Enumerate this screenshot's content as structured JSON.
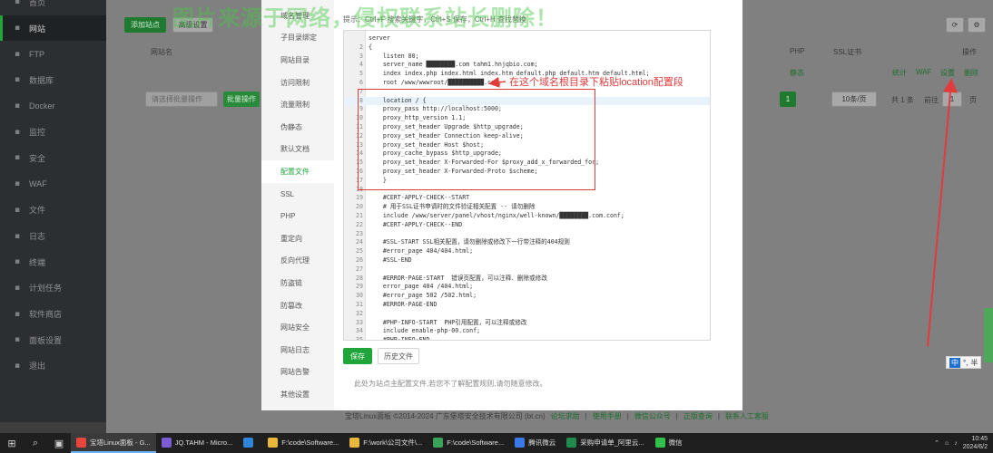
{
  "sidebar": {
    "items": [
      {
        "label": "首页",
        "icon": "home-icon"
      },
      {
        "label": "网站",
        "icon": "globe-icon"
      },
      {
        "label": "FTP",
        "icon": "ftp-icon"
      },
      {
        "label": "数据库",
        "icon": "database-icon"
      },
      {
        "label": "Docker",
        "icon": "docker-icon"
      },
      {
        "label": "监控",
        "icon": "monitor-icon"
      },
      {
        "label": "安全",
        "icon": "shield-icon"
      },
      {
        "label": "WAF",
        "icon": "firewall-icon"
      },
      {
        "label": "文件",
        "icon": "folder-icon"
      },
      {
        "label": "日志",
        "icon": "log-icon"
      },
      {
        "label": "终端",
        "icon": "terminal-icon"
      },
      {
        "label": "计划任务",
        "icon": "clock-icon"
      },
      {
        "label": "软件商店",
        "icon": "store-icon"
      },
      {
        "label": "面板设置",
        "icon": "gear-icon"
      },
      {
        "label": "退出",
        "icon": "logout-icon"
      }
    ],
    "active_index": 1
  },
  "background": {
    "add_site": "添加站点",
    "advanced": "高级设置",
    "col_site": "网站名",
    "col_php": "PHP",
    "col_ssl": "SSL证书",
    "col_action": "操作",
    "row_php": "静态",
    "row_actions": [
      "统计",
      "WAF",
      "设置",
      "删除"
    ],
    "batch_placeholder": "请选择批量操作",
    "batch_btn": "批量操作",
    "page_current": "1",
    "page_size": "10条/页",
    "total": "共 1 条",
    "goto": "前往",
    "goto_value": "1",
    "page_unit": "页"
  },
  "footer": {
    "copyright": "宝塔Linux面板 ©2014-2024 广东堡塔安全技术有限公司 (bt.cn)",
    "links": [
      "论坛求助",
      "使用手册",
      "微信公众号",
      "正版查询",
      "联系人工客服"
    ]
  },
  "watermark": "图片来源于网络，侵权联系站长删除！",
  "modal": {
    "nav": [
      "域名管理",
      "子目录绑定",
      "网站目录",
      "访问限制",
      "流量限制",
      "伪静态",
      "默认文档",
      "配置文件",
      "SSL",
      "PHP",
      "重定向",
      "反向代理",
      "防盗链",
      "防篡改",
      "网站安全",
      "网站日志",
      "网站告警",
      "其他设置"
    ],
    "active_nav": 7,
    "hint": "提示：Ctrl+F 搜索关键字，Ctrl+S 保存，Ctrl+H 查找替换",
    "save": "保存",
    "history": "历史文件",
    "note": "此处为站点主配置文件,若您不了解配置规则,请勿随意修改。",
    "annotation": "在这个域名根目录下粘贴location配置段"
  },
  "code": [
    {
      "n": "",
      "t": "server",
      "c": "c-blue"
    },
    {
      "n": "2",
      "t": "{",
      "c": "c-dark"
    },
    {
      "n": "3",
      "t": "    listen 80;",
      "c": "c-dark"
    },
    {
      "n": "4",
      "t": "    server_name ████████.com tahm1.hnjqbio.com;",
      "c": "c-dark"
    },
    {
      "n": "5",
      "t": "    index index.php index.html index.htm default.php default.htm default.html;",
      "c": "c-dark"
    },
    {
      "n": "6",
      "t": "    root /www/wwwroot/██████████.com;",
      "c": "c-dark"
    },
    {
      "n": "7",
      "t": "",
      "c": "c-dark"
    },
    {
      "n": "8",
      "t": "    location / {",
      "c": "c-dark"
    },
    {
      "n": "9",
      "t": "    proxy_pass http://localhost:5000;",
      "c": "c-dark"
    },
    {
      "n": "10",
      "t": "    proxy_http_version 1.1;",
      "c": "c-dark"
    },
    {
      "n": "11",
      "t": "    proxy_set_header Upgrade $http_upgrade;",
      "c": "c-dark"
    },
    {
      "n": "12",
      "t": "    proxy_set_header Connection keep-alive;",
      "c": "c-dark"
    },
    {
      "n": "13",
      "t": "    proxy_set_header Host $host;",
      "c": "c-dark"
    },
    {
      "n": "14",
      "t": "    proxy_cache_bypass $http_upgrade;",
      "c": "c-dark"
    },
    {
      "n": "15",
      "t": "    proxy_set_header X-Forwarded-For $proxy_add_x_forwarded_for;",
      "c": "c-dark"
    },
    {
      "n": "16",
      "t": "    proxy_set_header X-Forwarded-Proto $scheme;",
      "c": "c-dark"
    },
    {
      "n": "17",
      "t": "    }",
      "c": "c-dark"
    },
    {
      "n": "18",
      "t": "",
      "c": "c-dark"
    },
    {
      "n": "19",
      "t": "    #CERT-APPLY-CHECK--START",
      "c": "c-green"
    },
    {
      "n": "20",
      "t": "    # 用于SSL证书申请时的文件验证相关配置 -- 请勿删除",
      "c": "c-green"
    },
    {
      "n": "21",
      "t": "    include /www/server/panel/vhost/nginx/well-known/████████.com.conf;",
      "c": "c-dark"
    },
    {
      "n": "22",
      "t": "    #CERT-APPLY-CHECK--END",
      "c": "c-green"
    },
    {
      "n": "23",
      "t": "",
      "c": "c-dark"
    },
    {
      "n": "24",
      "t": "    #SSL-START SSL相关配置，请勿删除或修改下一行带注释的404规则",
      "c": "c-green"
    },
    {
      "n": "25",
      "t": "    #error_page 404/404.html;",
      "c": "c-green"
    },
    {
      "n": "26",
      "t": "    #SSL-END",
      "c": "c-green"
    },
    {
      "n": "27",
      "t": "",
      "c": "c-dark"
    },
    {
      "n": "28",
      "t": "    #ERROR-PAGE-START  错误页配置，可以注释、删除或修改",
      "c": "c-green"
    },
    {
      "n": "29",
      "t": "    error_page 404 /404.html;",
      "c": "c-dark"
    },
    {
      "n": "30",
      "t": "    #error_page 502 /502.html;",
      "c": "c-green"
    },
    {
      "n": "31",
      "t": "    #ERROR-PAGE-END",
      "c": "c-green"
    },
    {
      "n": "32",
      "t": "",
      "c": "c-dark"
    },
    {
      "n": "33",
      "t": "    #PHP-INFO-START  PHP引用配置，可以注释或修改",
      "c": "c-green"
    },
    {
      "n": "34",
      "t": "    include enable-php-00.conf;",
      "c": "c-dark"
    },
    {
      "n": "35",
      "t": "    #PHP-INFO-END",
      "c": "c-green"
    }
  ],
  "taskbar": {
    "tasks": [
      {
        "label": "宝塔Linux面板 - G...",
        "color": "#e8453c",
        "active": true
      },
      {
        "label": "JQ.TAHM - Micro...",
        "color": "#7b5cd6",
        "active": false
      },
      {
        "label": "",
        "color": "#2f86d8",
        "active": false
      },
      {
        "label": "F:\\code\\Software...",
        "color": "#e8b83c",
        "active": false
      },
      {
        "label": "F:\\work\\公司文件\\...",
        "color": "#e8b83c",
        "active": false
      },
      {
        "label": "F:\\code\\Software...",
        "color": "#3aa35a",
        "active": false
      },
      {
        "label": "腾讯微云",
        "color": "#3a7ae8",
        "active": false
      },
      {
        "label": "采购申请单_阿里云...",
        "color": "#1f8a4a",
        "active": false
      },
      {
        "label": "微信",
        "color": "#2ec24a",
        "active": false
      }
    ],
    "time": "10:45",
    "date": "2024/6/2"
  },
  "ime": {
    "lang": "中",
    "mode": "°,",
    "half": "半"
  },
  "accent": "#20a53a",
  "annotation_color": "#e23b3b"
}
